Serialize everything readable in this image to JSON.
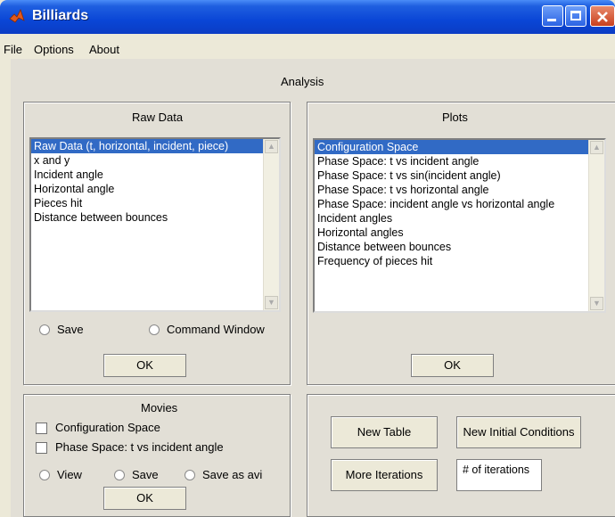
{
  "window": {
    "title": "Billiards",
    "app_icon": "matlab-icon"
  },
  "menu": [
    "File",
    "Options",
    "About"
  ],
  "heading": "Analysis",
  "raw_data": {
    "title": "Raw Data",
    "items": [
      "Raw Data (t, horizontal, incident, piece)",
      "x and y",
      "Incident angle",
      "Horizontal angle",
      "Pieces hit",
      "Distance between bounces"
    ],
    "selected_index": 0,
    "radio_save": "Save",
    "radio_command": "Command Window",
    "ok": "OK"
  },
  "plots": {
    "title": "Plots",
    "items": [
      "Configuration Space",
      "Phase Space:  t vs incident angle",
      "Phase Space:  t vs sin(incident angle)",
      "Phase Space:  t vs horizontal angle",
      "Phase Space:  incident angle vs horizontal angle",
      "Incident angles",
      "Horizontal angles",
      "Distance between bounces",
      "Frequency of pieces hit"
    ],
    "selected_index": 0,
    "ok": "OK"
  },
  "movies": {
    "title": "Movies",
    "checkbox_config": "Configuration Space",
    "checkbox_phase": "Phase Space:  t vs incident angle",
    "radio_view": "View",
    "radio_save": "Save",
    "radio_avi": "Save as avi",
    "ok": "OK"
  },
  "controls": {
    "new_table": "New Table",
    "new_initial": "New Initial Conditions",
    "more_iterations": "More Iterations",
    "iterations_field": "# of iterations"
  },
  "colors": {
    "selection": "#316ac5",
    "titlebar": "#0a46d6",
    "background": "#ece9d8"
  }
}
